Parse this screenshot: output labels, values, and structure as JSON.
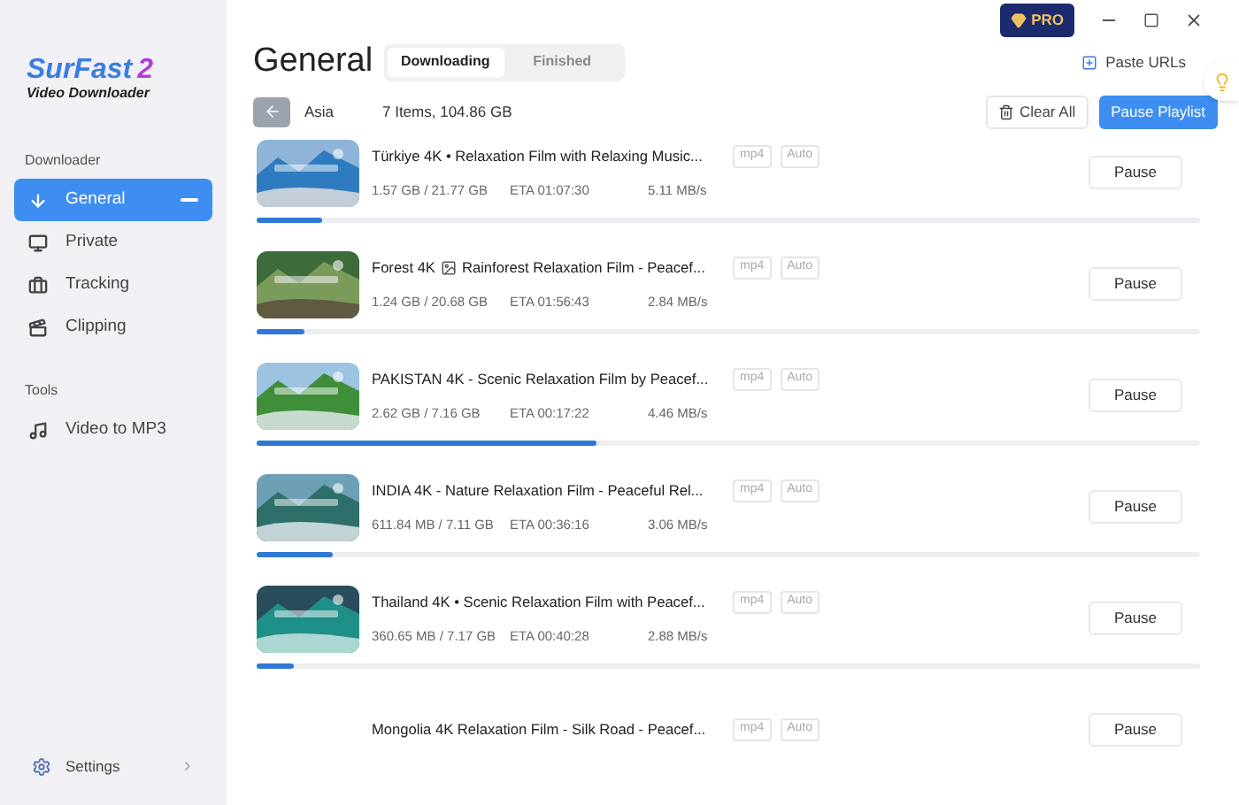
{
  "app": {
    "logo_name": "SurFast",
    "logo_number": "2",
    "logo_subtitle": "Video Downloader"
  },
  "sidebar": {
    "sections": [
      {
        "heading": "Downloader",
        "items": [
          {
            "label": "General",
            "kind": "download",
            "selected": true
          },
          {
            "label": "Private",
            "kind": "private",
            "selected": false
          },
          {
            "label": "Tracking",
            "kind": "tracking",
            "selected": false
          },
          {
            "label": "Clipping",
            "kind": "clipping",
            "selected": false
          }
        ]
      },
      {
        "heading": "Tools",
        "items": [
          {
            "label": "Video to MP3",
            "kind": "music",
            "selected": false
          }
        ]
      }
    ],
    "settings": {
      "label": "Settings"
    }
  },
  "title_bar": {
    "pro_badge": "PRO"
  },
  "header": {
    "title": "General",
    "tabs": [
      {
        "label": "Downloading",
        "selected": true
      },
      {
        "label": "Finished",
        "selected": false
      }
    ],
    "paste_urls": "Paste URLs"
  },
  "toolbar": {
    "playlist": "Asia",
    "summary": "7 Items, 104.86 GB",
    "clear_all": "Clear All",
    "pause_playlist": "Pause Playlist"
  },
  "downloads": [
    {
      "title": [
        "Türkiye 4K • Relaxation Film with Relaxing Music..."
      ],
      "format": "mp4",
      "quality": "Auto",
      "size": "1.57 GB / 21.77 GB",
      "eta": "ETA 01:07:30",
      "speed": "5.11 MB/s",
      "button": "Pause",
      "thumbnail": {
        "kind": "picture"
      },
      "level": 0.07
    },
    {
      "title": [
        "Forest 4K",
        "Rainforest Relaxation Film - Peacef..."
      ],
      "format": "mp4",
      "quality": "Auto",
      "size": "1.24 GB / 20.68 GB",
      "eta": "ETA 01:56:43",
      "speed": "2.84 MB/s",
      "button": "Pause",
      "thumbnail": {
        "kind": "picture"
      },
      "level": 0.05
    },
    {
      "title": [
        "PAKISTAN 4K - Scenic Relaxation Film by Peacef..."
      ],
      "format": "mp4",
      "quality": "Auto",
      "size": "2.62 GB / 7.16 GB",
      "eta": "ETA 00:17:22",
      "speed": "4.46 MB/s",
      "button": "Pause",
      "thumbnail": {
        "kind": "picture"
      },
      "level": 0.36
    },
    {
      "title": [
        "INDIA 4K - Nature Relaxation Film - Peaceful Rel..."
      ],
      "format": "mp4",
      "quality": "Auto",
      "size": "611.84 MB / 7.11 GB",
      "eta": "ETA 00:36:16",
      "speed": "3.06 MB/s",
      "button": "Pause",
      "thumbnail": {
        "kind": "picture"
      },
      "level": 0.08
    },
    {
      "title": [
        "Thailand 4K • Scenic Relaxation Film with Peacef..."
      ],
      "format": "mp4",
      "quality": "Auto",
      "size": "360.65 MB / 7.17 GB",
      "eta": "ETA 00:40:28",
      "speed": "2.88 MB/s",
      "button": "Pause",
      "thumbnail": {
        "kind": "picture"
      },
      "level": 0.04
    },
    {
      "title": [
        "Mongolia 4K Relaxation Film - Silk Road - Peacef..."
      ],
      "format": "mp4",
      "quality": "Auto",
      "button": "Pause"
    }
  ]
}
